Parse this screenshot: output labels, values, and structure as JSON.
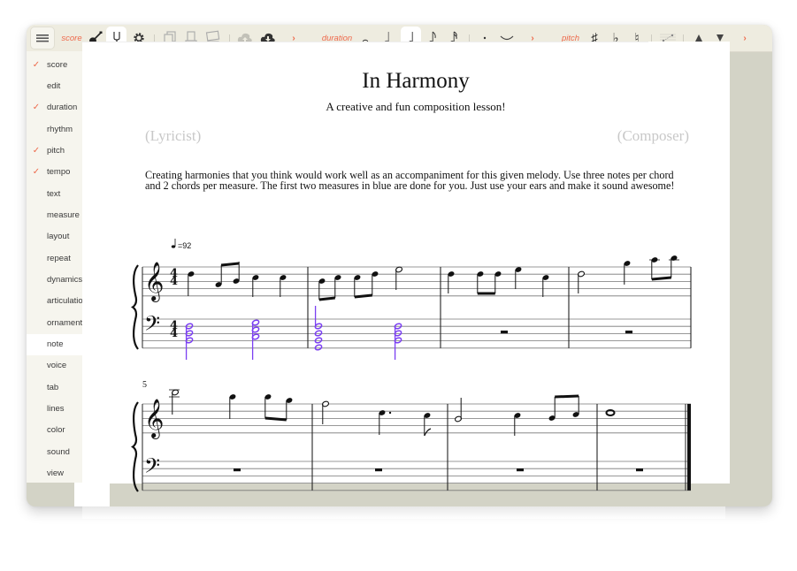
{
  "toolbar": {
    "groups": [
      {
        "label": "score",
        "items": [
          "menu-icon",
          "guitar-icon",
          "tuning-fork-icon",
          "gear-icon",
          "pages-icon",
          "print-icon",
          "photo-icon",
          "cloud-upload-icon",
          "cloud-download-icon"
        ],
        "more": "›"
      },
      {
        "label": "duration",
        "items": [
          "whole-note-icon",
          "half-note-icon",
          "quarter-note-icon",
          "eighth-note-icon",
          "sixteenth-note-icon",
          "dot-icon",
          "tie-icon"
        ],
        "more": "›",
        "selected": "quarter-note-icon"
      },
      {
        "label": "pitch",
        "items": [
          "sharp-icon",
          "flat-icon",
          "natural-icon",
          "transpose-icon",
          "pitch-up-icon",
          "pitch-down-icon"
        ],
        "more": "›"
      }
    ],
    "score_label": "score",
    "duration_label": "duration",
    "pitch_label": "pitch",
    "more_glyph": "›",
    "accent_color": "#ee6a4c"
  },
  "sidebar": {
    "items": [
      {
        "label": "score",
        "checked": true
      },
      {
        "label": "edit",
        "checked": false
      },
      {
        "label": "duration",
        "checked": true
      },
      {
        "label": "rhythm",
        "checked": false
      },
      {
        "label": "pitch",
        "checked": true
      },
      {
        "label": "tempo",
        "checked": true
      },
      {
        "label": "text",
        "checked": false
      },
      {
        "label": "measure",
        "checked": false
      },
      {
        "label": "layout",
        "checked": false
      },
      {
        "label": "repeat",
        "checked": false
      },
      {
        "label": "dynamics",
        "checked": false
      },
      {
        "label": "articulation",
        "checked": false
      },
      {
        "label": "ornament",
        "checked": false
      },
      {
        "label": "note",
        "checked": false,
        "active": true
      },
      {
        "label": "voice",
        "checked": false
      },
      {
        "label": "tab",
        "checked": false
      },
      {
        "label": "lines",
        "checked": false
      },
      {
        "label": "color",
        "checked": false
      },
      {
        "label": "sound",
        "checked": false
      },
      {
        "label": "view",
        "checked": false
      }
    ],
    "check_glyph": "✓"
  },
  "score": {
    "title": "In Harmony",
    "subtitle": "A creative and fun composition lesson!",
    "lyricist": "(Lyricist)",
    "composer": "(Composer)",
    "instructions": "Creating harmonies that you think would work well as an accompaniment for this given melody. Use three notes per chord and 2 chords per measure. The first two measures in blue are done for you. Just use your ears and make it sound awesome!",
    "tempo_text": "=92",
    "time_signature": "4/4",
    "system2_measure_number": "5",
    "chord_color": "#7b3ff2"
  }
}
